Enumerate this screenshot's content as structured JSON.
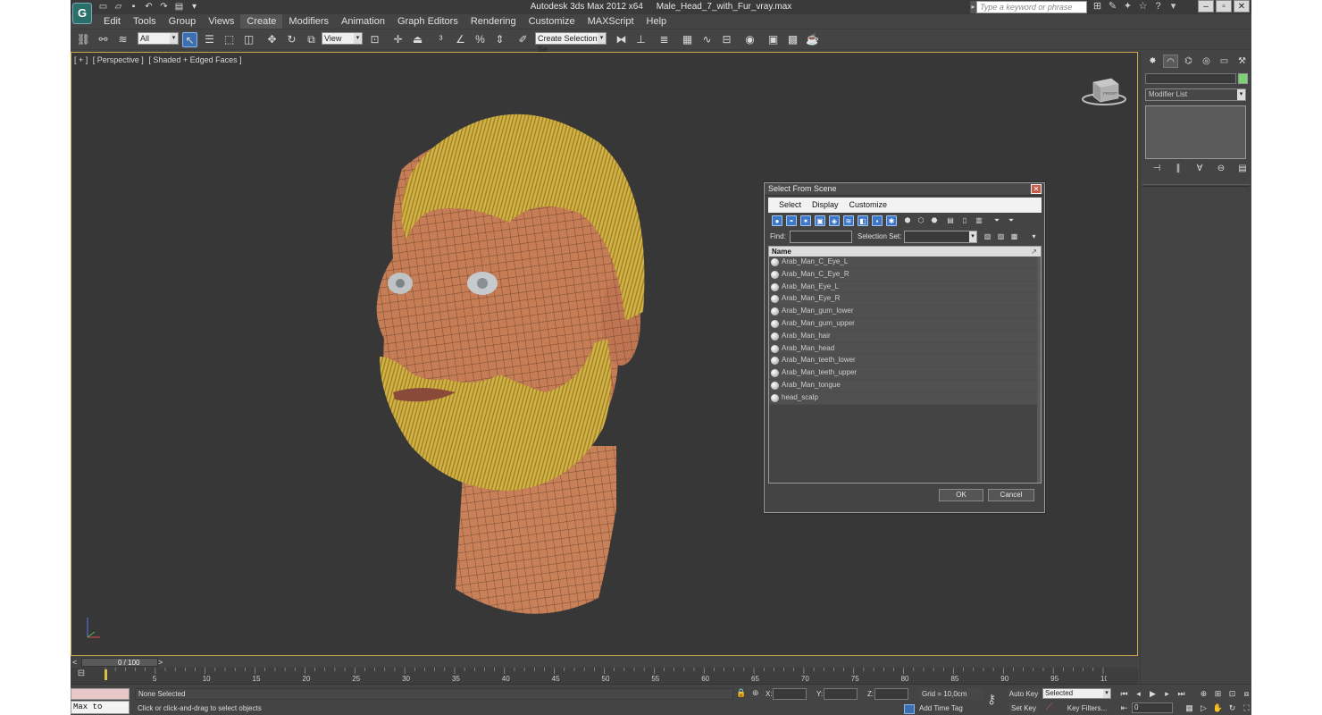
{
  "window": {
    "app_name": "Autodesk 3ds Max  2012 x64",
    "file_name": "Male_Head_7_with_Fur_vray.max",
    "search_placeholder": "Type a keyword or phrase"
  },
  "menu": [
    "Edit",
    "Tools",
    "Group",
    "Views",
    "Create",
    "Modifiers",
    "Animation",
    "Graph Editors",
    "Rendering",
    "Customize",
    "MAXScript",
    "Help"
  ],
  "toolbar": {
    "selection_filter": "All",
    "ref_coord": "View",
    "named_selection_placeholder": "Create Selection Se"
  },
  "viewport": {
    "label_bracket": "[ + ]",
    "label_view": "[ Perspective ]",
    "label_shading": "[ Shaded + Edged Faces ]",
    "viewcube_face": "FRONT"
  },
  "dialog": {
    "title": "Select From Scene",
    "menu": [
      "Select",
      "Display",
      "Customize"
    ],
    "find_label": "Find:",
    "find_value": "",
    "selection_set_label": "Selection Set:",
    "selection_set_value": "",
    "column_header": "Name",
    "objects": [
      "Arab_Man_C_Eye_L",
      "Arab_Man_C_Eye_R",
      "Arab_Man_Eye_L",
      "Arab_Man_Eye_R",
      "Arab_Man_gum_lower",
      "Arab_Man_gum_upper",
      "Arab_Man_hair",
      "Arab_Man_head",
      "Arab_Man_teeth_lower",
      "Arab_Man_teeth_upper",
      "Arab_Man_tongue",
      "head_scalp"
    ],
    "ok_label": "OK",
    "cancel_label": "Cancel"
  },
  "command_panel": {
    "modifier_list_label": "Modifier List",
    "object_color": "#7ad073"
  },
  "timeline": {
    "frame_display": "0 / 100",
    "ticks": [
      "5",
      "10",
      "15",
      "20",
      "25",
      "30",
      "35",
      "40",
      "45",
      "50",
      "55",
      "60",
      "65",
      "70",
      "75",
      "80",
      "85",
      "90",
      "95",
      "100"
    ]
  },
  "status": {
    "selection": "None Selected",
    "prompt": "Click or click-and-drag to select objects",
    "maxscript": "Max to Physc",
    "x_label": "X:",
    "y_label": "Y:",
    "z_label": "Z:",
    "grid": "Grid = 10,0cm",
    "add_time_tag": "Add Time Tag",
    "auto_key": "Auto Key",
    "set_key": "Set Key",
    "key_mode": "Selected",
    "key_filters": "Key Filters...",
    "current_frame": "0"
  },
  "colors": {
    "viewport_bg": "#373737",
    "viewport_border": "#c8a64a",
    "ui_bg": "#444444",
    "highlight": "#3c6fb0"
  }
}
